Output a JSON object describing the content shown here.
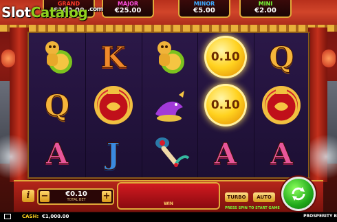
{
  "logo": {
    "slot": "Slot",
    "catalog": "Catalog",
    "com": ".com"
  },
  "jackpots": [
    {
      "label": "GRAND",
      "value": "€100.00"
    },
    {
      "label": "MAJOR",
      "value": "€25.00"
    },
    {
      "label": "MINOR",
      "value": "€5.00"
    },
    {
      "label": "MINI",
      "value": "€2.00"
    }
  ],
  "reels": [
    [
      {
        "symbol": "monkey-icon",
        "text": ""
      },
      {
        "symbol": "Q",
        "text": "Q"
      },
      {
        "symbol": "A",
        "text": "A"
      }
    ],
    [
      {
        "symbol": "K",
        "text": "K"
      },
      {
        "symbol": "vase-icon",
        "text": ""
      },
      {
        "symbol": "J",
        "text": "J"
      }
    ],
    [
      {
        "symbol": "monkey-icon",
        "text": ""
      },
      {
        "symbol": "fish-icon",
        "text": ""
      },
      {
        "symbol": "ruyi-icon",
        "text": ""
      }
    ],
    [
      {
        "symbol": "coin",
        "text": "0.10"
      },
      {
        "symbol": "coin",
        "text": "0.10"
      },
      {
        "symbol": "A",
        "text": "A"
      }
    ],
    [
      {
        "symbol": "Q",
        "text": "Q"
      },
      {
        "symbol": "vase-icon",
        "text": ""
      },
      {
        "symbol": "A",
        "text": "A"
      }
    ]
  ],
  "controls": {
    "info": "i",
    "minus": "−",
    "plus": "+",
    "bet_value": "€0.10",
    "bet_label": "TOTAL BET",
    "win_label": "WIN",
    "turbo": "TURBO",
    "auto": "AUTO",
    "press_text": "PRESS SPIN TO START GAME"
  },
  "status": {
    "cash_label": "CASH:",
    "cash_value": "€1,000.00",
    "game_name": "PROSPERITY B"
  },
  "colors": {
    "grand": "#ff3b2a",
    "major": "#ff4fe0",
    "minor": "#3fa9ff",
    "mini": "#7bff3a",
    "spin": "#1fa81a"
  }
}
